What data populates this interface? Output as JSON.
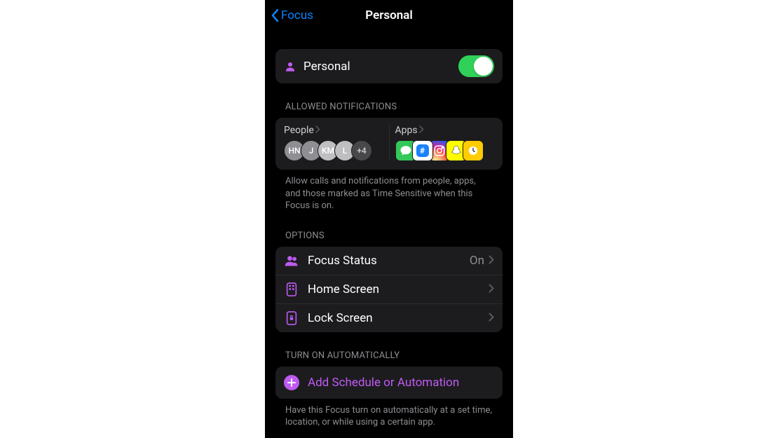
{
  "nav": {
    "back_label": "Focus",
    "title": "Personal"
  },
  "focus": {
    "name": "Personal",
    "enabled": true
  },
  "allowed": {
    "header": "ALLOWED NOTIFICATIONS",
    "people_label": "People",
    "apps_label": "Apps",
    "people": [
      "HN",
      "J",
      "KM",
      "L"
    ],
    "people_more": "+4",
    "apps": [
      "messages",
      "groupme",
      "instagram",
      "snapchat",
      "clock"
    ],
    "footer": "Allow calls and notifications from people, apps, and those marked as Time Sensitive when this Focus is on."
  },
  "options": {
    "header": "OPTIONS",
    "rows": [
      {
        "label": "Focus Status",
        "value": "On"
      },
      {
        "label": "Home Screen",
        "value": ""
      },
      {
        "label": "Lock Screen",
        "value": ""
      }
    ]
  },
  "automation": {
    "header": "TURN ON AUTOMATICALLY",
    "add_label": "Add Schedule or Automation",
    "footer": "Have this Focus turn on automatically at a set time, location, or while using a certain app."
  }
}
